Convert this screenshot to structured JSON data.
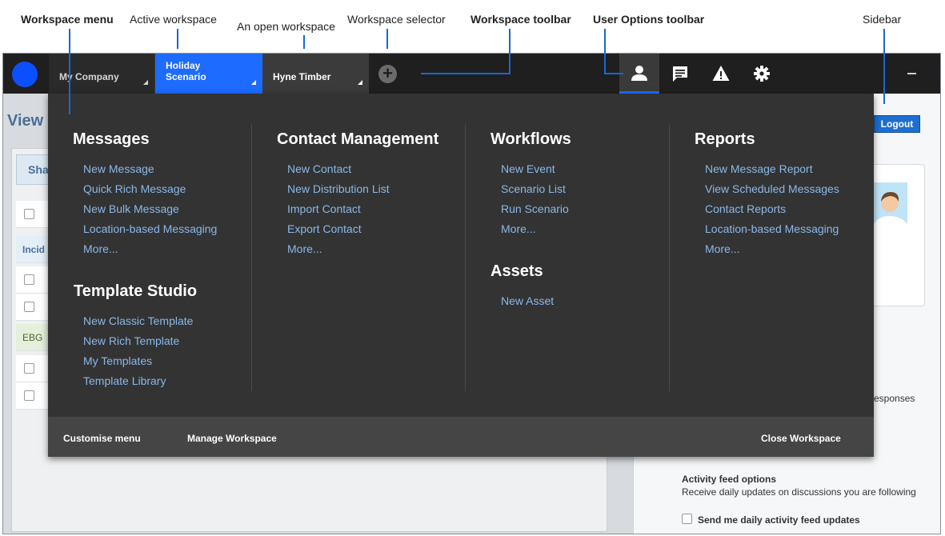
{
  "annotations": {
    "workspace_menu": "Workspace menu",
    "active_workspace": "Active workspace",
    "open_workspace": "An open workspace",
    "workspace_selector": "Workspace selector",
    "workspace_toolbar": "Workspace toolbar",
    "user_options_toolbar": "User Options toolbar",
    "sidebar": "Sidebar"
  },
  "topbar": {
    "workspaces": [
      {
        "label": "My Company"
      },
      {
        "label_line1": "Holiday",
        "label_line2": "Scenario"
      },
      {
        "label": "Hyne Timber"
      }
    ],
    "add_symbol": "+",
    "tools": [
      "user-icon",
      "chat-icon",
      "warning-icon",
      "gear-icon"
    ],
    "accent_color": "#1d6bff"
  },
  "background": {
    "view_title": "View",
    "share_fragment": "Sha",
    "row_blue_fragment": "Incid",
    "row_green_fragment": "EBG",
    "logout": "Logout",
    "responses_fragment": "esponses",
    "feed_title": "Activity feed options",
    "feed_desc": "Receive daily updates on discussions you are following",
    "feed_checkbox_label": "Send me daily activity feed updates"
  },
  "menu": {
    "messages": {
      "title": "Messages",
      "items": [
        "New Message",
        "Quick Rich Message",
        "New Bulk Message",
        "Location-based Messaging",
        "More..."
      ]
    },
    "template_studio": {
      "title": "Template Studio",
      "items": [
        "New Classic Template",
        "New Rich Template",
        "My Templates",
        "Template Library"
      ]
    },
    "contact_management": {
      "title": "Contact Management",
      "items": [
        "New Contact",
        "New Distribution List",
        "Import Contact",
        "Export Contact",
        "More..."
      ]
    },
    "workflows": {
      "title": "Workflows",
      "items": [
        "New Event",
        "Scenario List",
        "Run Scenario",
        "More..."
      ]
    },
    "assets": {
      "title": "Assets",
      "items": [
        "New Asset"
      ]
    },
    "reports": {
      "title": "Reports",
      "items": [
        "New Message Report",
        "View Scheduled Messages",
        "Contact Reports",
        "Location-based Messaging",
        "More..."
      ]
    },
    "footer": {
      "customise": "Customise menu",
      "manage": "Manage Workspace",
      "close": "Close Workspace"
    }
  }
}
